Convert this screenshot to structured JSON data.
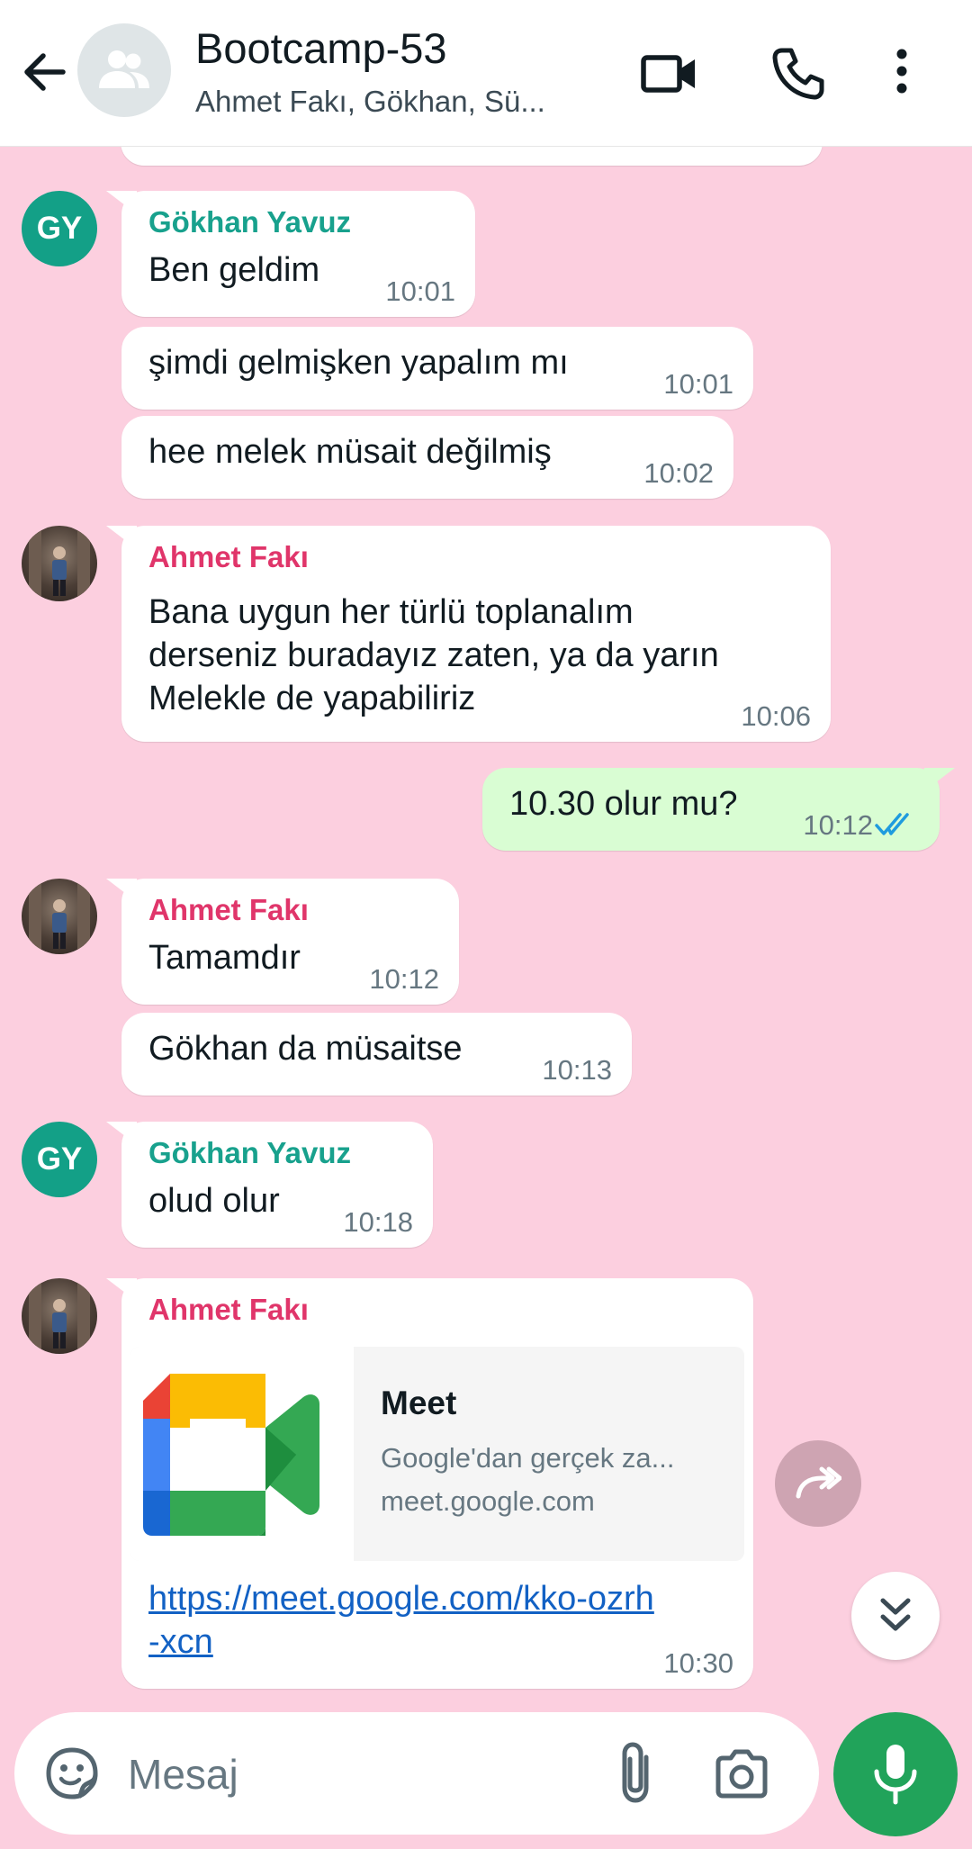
{
  "header": {
    "title": "Bootcamp-53",
    "subtitle": "Ahmet Fakı, Gökhan, Sü..."
  },
  "messages": [
    {
      "sender": "Gökhan Yavuz",
      "avatar_initials": "GY",
      "text": "Ben geldim",
      "time": "10:01"
    },
    {
      "text": "şimdi gelmişken yapalım mı",
      "time": "10:01"
    },
    {
      "text": "hee melek müsait değilmiş",
      "time": "10:02"
    },
    {
      "sender": "Ahmet Fakı",
      "lines": [
        "Bana uygun her türlü toplanalım",
        "derseniz buradayız zaten, ya da yarın",
        "Melekle de yapabiliriz"
      ],
      "time": "10:06"
    },
    {
      "text": "10.30 olur mu?",
      "time": "10:12",
      "status": "read"
    },
    {
      "sender": "Ahmet Fakı",
      "text": "Tamamdır",
      "time": "10:12"
    },
    {
      "text": "Gökhan da müsaitse",
      "time": "10:13"
    },
    {
      "sender": "Gökhan Yavuz",
      "avatar_initials": "GY",
      "text": "olud olur",
      "time": "10:18"
    },
    {
      "sender": "Ahmet Fakı",
      "link_preview": {
        "title": "Meet",
        "description": "Google'dan gerçek za...",
        "domain": "meet.google.com"
      },
      "url_lines": [
        "https://meet.google.com/kko-ozrh",
        "-xcn"
      ],
      "time": "10:30"
    }
  ],
  "composer": {
    "placeholder": "Mesaj"
  },
  "icons": {
    "back": "arrow-left-icon",
    "video": "video-camera-icon",
    "call": "phone-icon",
    "menu": "more-vertical-icon",
    "sticker": "sticker-icon",
    "attach": "paperclip-icon",
    "camera": "camera-icon",
    "mic": "microphone-icon",
    "forward": "forward-icon",
    "scroll": "chevron-double-down-icon"
  },
  "colors": {
    "chat_background": "#fccfdf",
    "outgoing_bubble": "#d9fdd3",
    "gokhan_name": "#18a18d",
    "ahmet_name": "#e0356a",
    "mic_button": "#21a35a",
    "read_ticks": "#1f9bde"
  }
}
